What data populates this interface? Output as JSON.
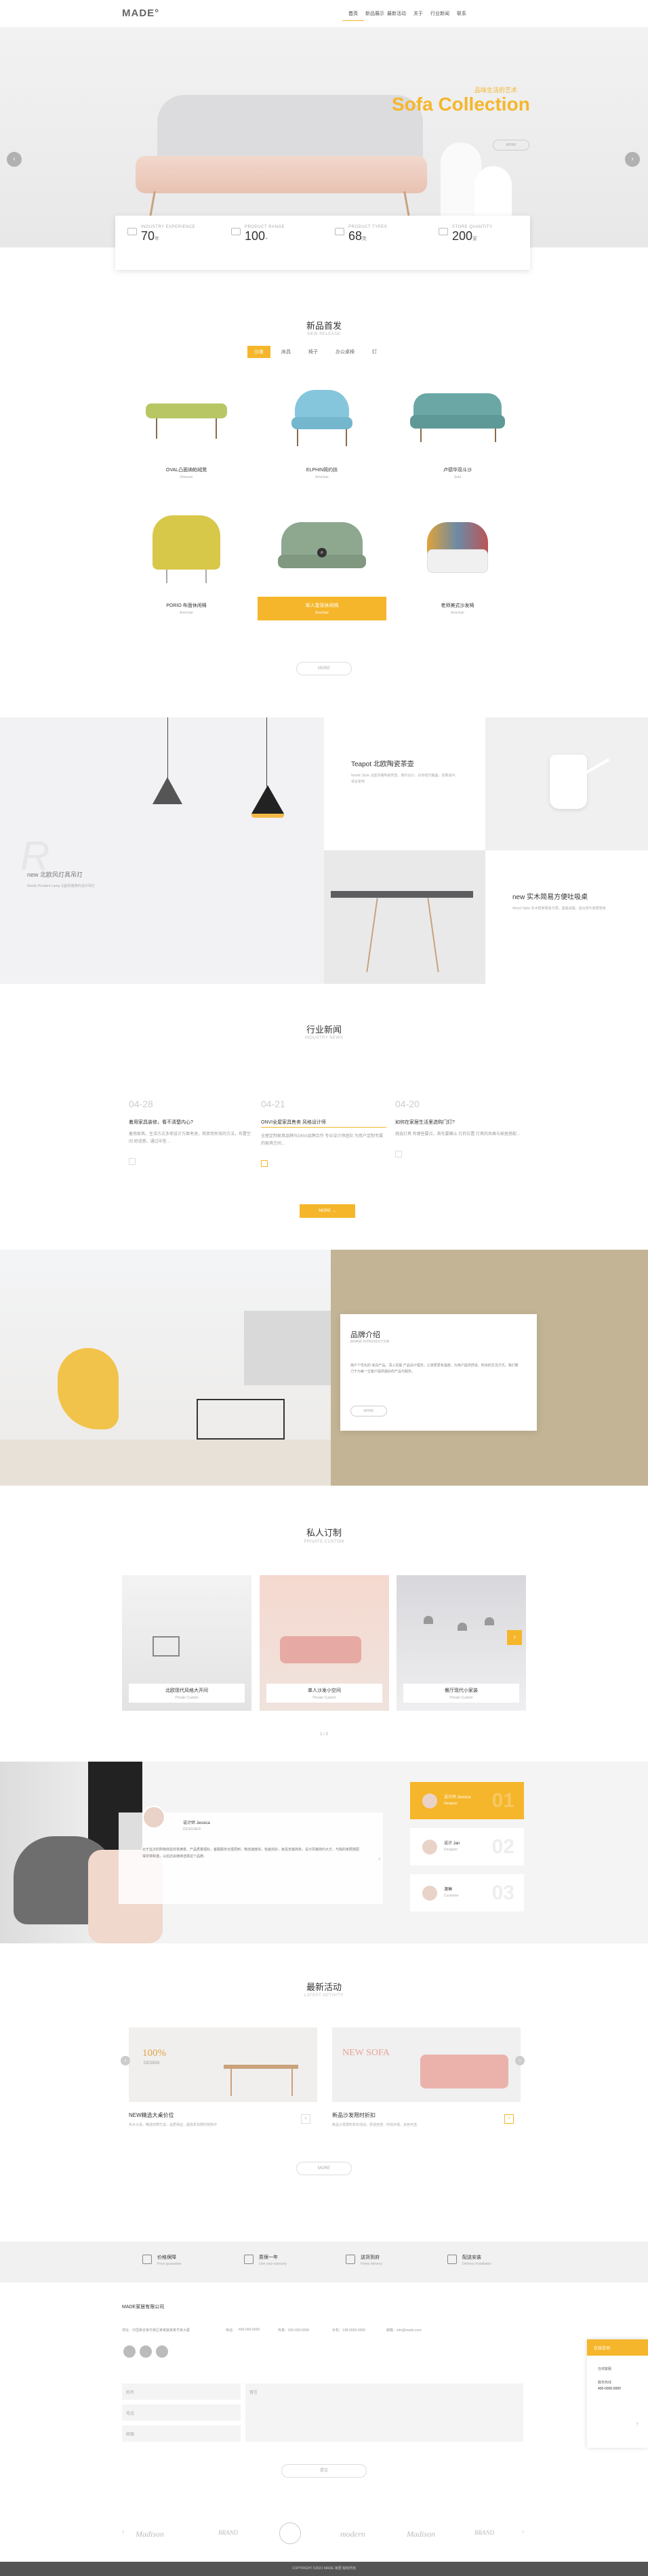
{
  "header": {
    "logo": "MADE°",
    "nav": [
      "首页",
      "新品展示",
      "最新活动",
      "关于",
      "行业新闻",
      "联系"
    ]
  },
  "hero": {
    "kicker": "品味生活的艺术",
    "title": "Sofa Collection",
    "button": "MORE",
    "stats": [
      {
        "label": "INDUSTRY EXPERIENCE",
        "value": "70",
        "unit": "年"
      },
      {
        "label": "PRODUCT RANGE",
        "value": "100",
        "unit": "+"
      },
      {
        "label": "PRODUCT TYPES",
        "value": "68",
        "unit": "类"
      },
      {
        "label": "STORE QUANTITY",
        "value": "200",
        "unit": "家"
      }
    ]
  },
  "products": {
    "title": "新品首发",
    "subtitle": "NEW RELEASE",
    "tabs": [
      "沙发",
      "床具",
      "椅子",
      "办公桌椅",
      "灯"
    ],
    "items": [
      {
        "name": "OVAL凸面纳帕绒凳",
        "sub": "Ottoman"
      },
      {
        "name": "ELPHIN简约扶",
        "sub": "Armchair"
      },
      {
        "name": "卢德华双斗沙",
        "sub": "Sofa"
      },
      {
        "name": "PORIO 布面休闲椅",
        "sub": "Armchair"
      },
      {
        "name": "单人靠背休闲椅",
        "sub": "Armchair"
      },
      {
        "name": "老师美式沙发椅",
        "sub": "Armchair"
      }
    ],
    "more": "MORE"
  },
  "showcase": {
    "left_title": "new 北欧风灯具吊灯",
    "left_text": "Nordic Pendant Lamp 北欧风格简约设计吊灯",
    "card1_title": "Teapot 北欧陶瓷茶壶",
    "card1_text": "Nordic Style 北欧风格陶瓷茶壶，简约设计，白色哑光釉面，容量适中，适合家用",
    "card2_title": "new 实木简易方便吐吸桌",
    "card2_text": "Wood Table 实木框架简易方便，金属桌腿，适合现代家居使用"
  },
  "news": {
    "title": "行业新闻",
    "subtitle": "INDUSTRY NEWS",
    "items": [
      {
        "date": "04-28",
        "title": "着用家具装修，看不清楚内心?",
        "text": "着用家具，生活方式多项设计方面考虑，简单而有效的方法，布置空间 舒适感，通过中型…"
      },
      {
        "date": "04-21",
        "title": "ONVI全屋家具售卖 风格设计师",
        "text": "全屋定制家具品牌与ONVI品牌合作 专业设计师团队 为用户定制专属的家具空间…"
      },
      {
        "date": "04-20",
        "title": "如何在家居生活里选购门灯?",
        "text": "挑选灯具 有哪些要点，首先要确认 灯的位置 灯具的风格与家居搭配…"
      }
    ],
    "more": "MORE →"
  },
  "brand": {
    "title": "品牌介绍",
    "subtitle": "BRAND INTRODUCTION",
    "text": "用户个性化的 家具产品，深入挖掘 产品设计理念，让家居更有温度，为用户提供舒适、时尚的生活方式。我们致力于为每一位客户提供最好的产品与服务。",
    "button": "MORE"
  },
  "custom": {
    "title": "私人订制",
    "subtitle": "PRIVATE CUSTOM",
    "items": [
      {
        "name": "北欧现代风格大开间",
        "sub": "Private Custom"
      },
      {
        "name": "单人沙发小空间",
        "sub": "Private Custom"
      },
      {
        "name": "餐厅现代小家装",
        "sub": "Private Custom"
      }
    ],
    "page": "1 / 3"
  },
  "testimonials": {
    "name": "设计师 Jessica",
    "role": "DESIGNER",
    "quote": "对于这次的购物体验非常满意，产品质量很好，客服服务也很周到，物流速度快，包装完好，家具安装简单，设计风格简约大方，与我的家居搭配得非常和谐，以后还会继续选择这个品牌。",
    "cards": [
      {
        "name": "设计师 Jessica",
        "sub": "Designer",
        "num": "01"
      },
      {
        "name": "设计 Jan",
        "sub": "Designer",
        "num": "02"
      },
      {
        "name": "澳琳",
        "sub": "Customer",
        "num": "03"
      }
    ]
  },
  "activities": {
    "title": "最新活动",
    "subtitle": "LATEST ACTIVITY",
    "items": [
      {
        "badge": "100%",
        "badge2": "DESIGN",
        "title": "NEW精选大桌价位",
        "text": "实木大桌，精选材质打造，品质保证，超低折扣限时抢购中"
      },
      {
        "badge": "NEW SOFA",
        "badge2": "",
        "title": "新品沙发限时折扣",
        "text": "新品沙发限时折扣活动，舒适坐感，时尚外观，多色可选"
      }
    ],
    "more": "MORE"
  },
  "features": [
    {
      "title": "价格保障",
      "sub": "Price guarantee"
    },
    {
      "title": "质保一年",
      "sub": "One year warranty"
    },
    {
      "title": "送货到府",
      "sub": "Home delivery"
    },
    {
      "title": "配送安装",
      "sub": "Delivery installation"
    }
  ],
  "contact": {
    "company": "MADE家居有限公司",
    "address": "地址：中国某省某市某区某某路某某号某大厦",
    "phone_label": "电话：",
    "phone": "400-000-0000",
    "fax": "传真：020-000-0000",
    "mobile": "手机：138-0000-0000",
    "email": "邮箱：info@made.com",
    "field_name": "姓名",
    "field_phone": "电话",
    "field_email": "邮箱",
    "field_message": "留言",
    "submit": "提交"
  },
  "float": {
    "title": "在线咨询",
    "item1": "在线客服",
    "item2": "服务热线",
    "phone": "400-0000-0000"
  },
  "partners": [
    "Madison",
    "BRAND",
    "",
    "modern",
    "Madison",
    "BRAND"
  ],
  "footer": "COPYRIGHT ©2021 MADE 家居 版权所有"
}
